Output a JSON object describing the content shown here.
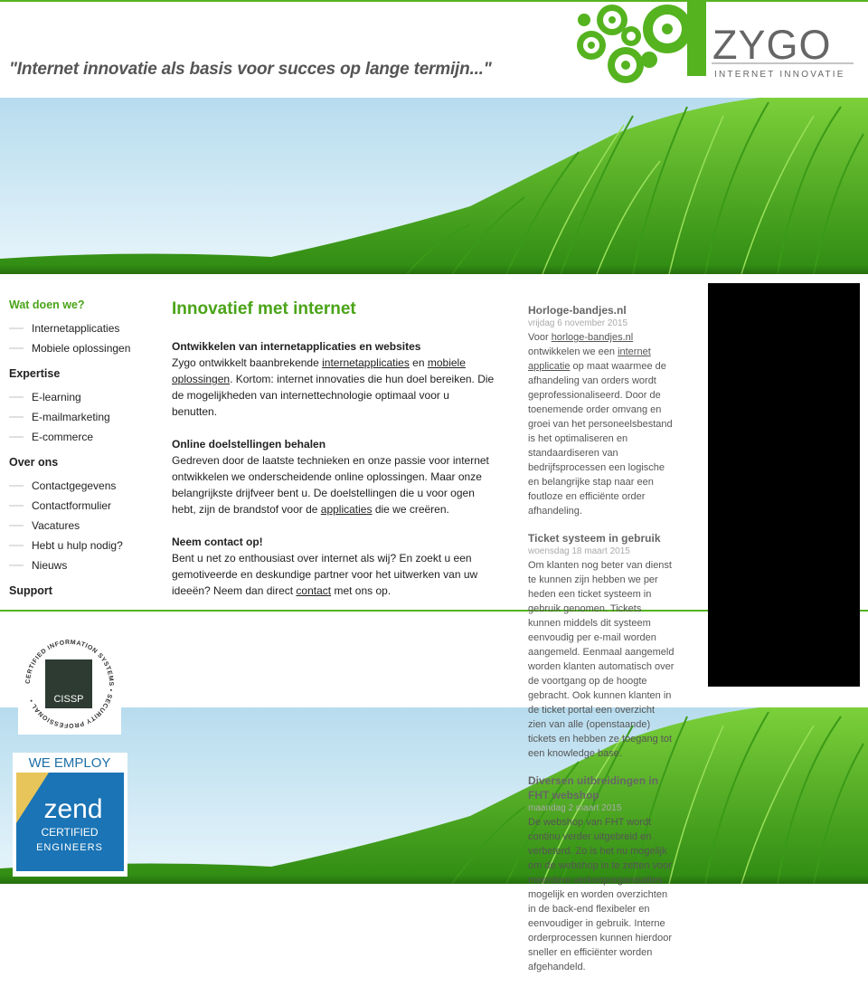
{
  "header": {
    "tagline": "\"Internet innovatie als basis voor succes op lange termijn...\"",
    "logo_name": "ZYGO",
    "logo_sub": "INTERNET INNOVATIE"
  },
  "nav": {
    "sections": [
      {
        "title": "Wat doen we?",
        "items": [
          "Internetapplicaties",
          "Mobiele oplossingen"
        ]
      },
      {
        "title": "Expertise",
        "items": [
          "E-learning",
          "E-mailmarketing",
          "E-commerce"
        ]
      },
      {
        "title": "Over ons",
        "items": [
          "Contactgegevens",
          "Contactformulier",
          "Vacatures",
          "Hebt u hulp nodig?",
          "Nieuws"
        ]
      },
      {
        "title": "Support",
        "items": []
      }
    ]
  },
  "main": {
    "title": "Innovatief met internet",
    "s1_title": "Ontwikkelen van internetapplicaties en websites",
    "s1_a": "Zygo ontwikkelt baanbrekende ",
    "s1_link1": "internetapplicaties",
    "s1_b": " en ",
    "s1_link2": "mobiele oplossingen",
    "s1_c": ". Kortom: internet innovaties die hun doel bereiken. Die de mogelijkheden van internettechnologie optimaal voor u benutten.",
    "s2_title": "Online doelstellingen behalen",
    "s2_a": "Gedreven door de laatste technieken en onze passie voor internet ontwikkelen we onderscheidende online oplossingen. Maar onze belangrijkste drijfveer bent u. De doelstellingen die u voor ogen hebt, zijn de brandstof voor de ",
    "s2_link": "applicaties",
    "s2_b": " die we creëren.",
    "s3_title": "Neem contact op!",
    "s3_a": "Bent u net zo enthousiast over internet als wij? En zoekt u een gemotiveerde en deskundige partner voor het uitwerken van uw ideeën? Neem dan direct ",
    "s3_link": "contact",
    "s3_b": " met ons op."
  },
  "news": {
    "a1_title": "Horloge-bandjes.nl",
    "a1_date": "vrijdag 6 november 2015",
    "a1_t1": "Voor ",
    "a1_l1": "horloge-bandjes.nl",
    "a1_t2": " ontwikkelen we een ",
    "a1_l2": "internet applicatie",
    "a1_t3": " op maat waarmee de afhandeling van orders wordt geprofessionaliseerd. Door de toenemende order omvang en groei van het personeelsbestand is het optimaliseren en standaardiseren van bedrijfsprocessen een logische en belangrijke stap naar een foutloze en efficiënte order afhandeling.",
    "a2_title": "Ticket systeem in gebruik",
    "a2_date": "woensdag 18 maart 2015",
    "a2_text": "Om klanten nog beter van dienst te kunnen zijn hebben we per heden een ticket systeem in gebruik genomen. Tickets kunnen middels dit systeem eenvoudig per e-mail worden aangemeld. Eenmaal aangemeld worden klanten automatisch over de voortgang op de hoogte gebracht. Ook kunnen klanten in de ticket portal een overzicht zien van alle (openstaande) tickets en hebben ze toegang tot een knowledge base.",
    "a3_title": "Diversen uitbreidingen in FHT webshop",
    "a3_date": "maandag 2 maart 2015",
    "a3_text": "De webshop van FHT wordt continu verder uitgebreid en verbeterd. Zo is het nu mogelijk om de webshop in te zetten voor meerdere verkooporganisaties mogelijk en worden overzichten in de back-end flexibeler en eenvoudiger in gebruik. Interne orderprocessen kunnen hierdoor sneller en efficiënter worden afgehandeld."
  },
  "badges": {
    "cissp_ring": "CERTIFIED INFORMATION SYSTEMS • SECURITY PROFESSIONAL •",
    "cissp_label": "CISSP",
    "zend_top": "WE EMPLOY",
    "zend_brand": "zend",
    "zend_line1": "CERTIFIED",
    "zend_line2": "ENGINEERS"
  },
  "colors": {
    "accent": "#4aa418",
    "text": "#222222"
  }
}
